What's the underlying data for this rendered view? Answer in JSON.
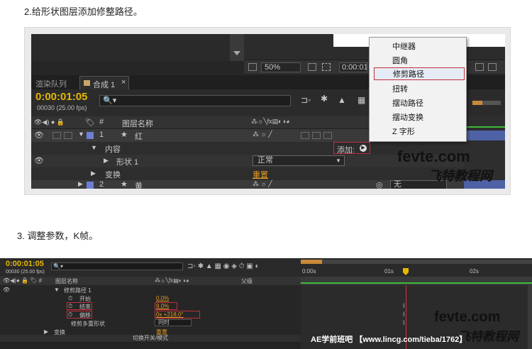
{
  "step2": "2.给形状图层添加修整路径。",
  "step3": "3. 调整参数，K帧。",
  "shot1": {
    "zoom": "50%",
    "timecode_partial": "0:00:01",
    "tab_render_queue": "渲染队列",
    "tab_comp": "合成 1",
    "timecode": "0:00:01:05",
    "frames": "00030 (25.00 fps)",
    "search_icon": "🔍▾",
    "col_num": "#",
    "col_name": "图层名称",
    "layer1_num": "1",
    "layer1_name": "红",
    "content": "内容",
    "shape1": "形状 1",
    "transform": "变换",
    "add_label": "添加:",
    "blend_mode": "正常",
    "reset": "重置",
    "layer2_num": "2",
    "layer2_name": "黄",
    "layer2_parent": "无",
    "menu": [
      "中继器",
      "圆角",
      "修剪路径",
      "扭转",
      "摆动路径",
      "摆动变换",
      "Z 字形"
    ],
    "watermark1": "fevte.com",
    "watermark2": "飞特教程网"
  },
  "shot2": {
    "timecode": "0:00:01:05",
    "frames": "00030 (25.00 fps)",
    "col_name": "图层名称",
    "col_parent": "父级",
    "trim_paths": "修剪路径 1",
    "start": "开始",
    "start_val": "0.0%",
    "end": "结束",
    "end_val": "9.0%",
    "offset": "偏移",
    "offset_val": "0x +218.0°",
    "trim_multi": "修剪多重形状",
    "trim_multi_val": "同时",
    "transform": "变换",
    "reset": "重置",
    "toggle": "切换开关/模式",
    "ruler": [
      "0:00s",
      "01s",
      "02s"
    ],
    "watermark1": "fevte.com",
    "watermark2": "飞特教程网",
    "credit": "AE学前班吧 【www.lincg.com/tieba/1762】"
  }
}
